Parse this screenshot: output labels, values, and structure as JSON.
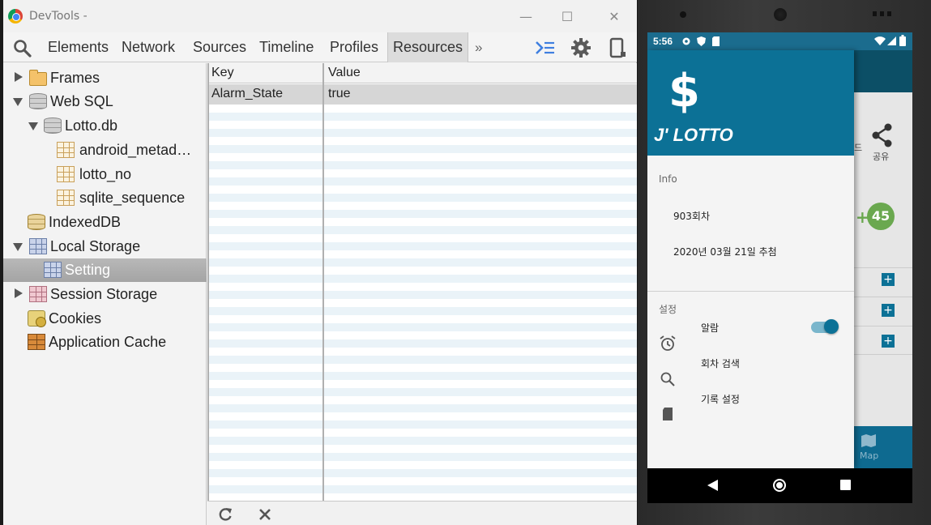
{
  "window": {
    "title": "DevTools -",
    "minimize": "—",
    "maximize": "☐",
    "close": "✕"
  },
  "tabs": {
    "items": [
      "Elements",
      "Network",
      "Sources",
      "Timeline",
      "Profiles",
      "Resources"
    ],
    "active": "Resources",
    "more": "»"
  },
  "tree": {
    "frames": "Frames",
    "websql": "Web SQL",
    "lottodb": "Lotto.db",
    "android_metadata": "android_metad…",
    "lotto_no": "lotto_no",
    "sqlite_sequence": "sqlite_sequence",
    "indexeddb": "IndexedDB",
    "local_storage": "Local Storage",
    "setting": "Setting",
    "session_storage": "Session Storage",
    "cookies": "Cookies",
    "app_cache": "Application Cache"
  },
  "grid": {
    "columns": [
      "Key",
      "Value"
    ],
    "rows": [
      {
        "key": "Alarm_State",
        "value": "true"
      }
    ]
  },
  "phone": {
    "status": {
      "time": "5:56"
    },
    "behind": {
      "share_label": "공유",
      "badge": "45",
      "bottom_label": "Map",
      "left_char": "드"
    },
    "drawer": {
      "symbol": "$",
      "app_name": "J' LOTTO",
      "info_label": "Info",
      "round": "903회차",
      "draw_date": "2020년 03월 21일 추첨",
      "settings_label": "설정",
      "alarm": "알람",
      "alarm_on": true,
      "search": "회차 검색",
      "record": "기록 설정"
    }
  },
  "colors": {
    "drawer_header": "#0c7196",
    "status_bar": "#1b6c8e",
    "badge_green": "#6aa84f"
  }
}
